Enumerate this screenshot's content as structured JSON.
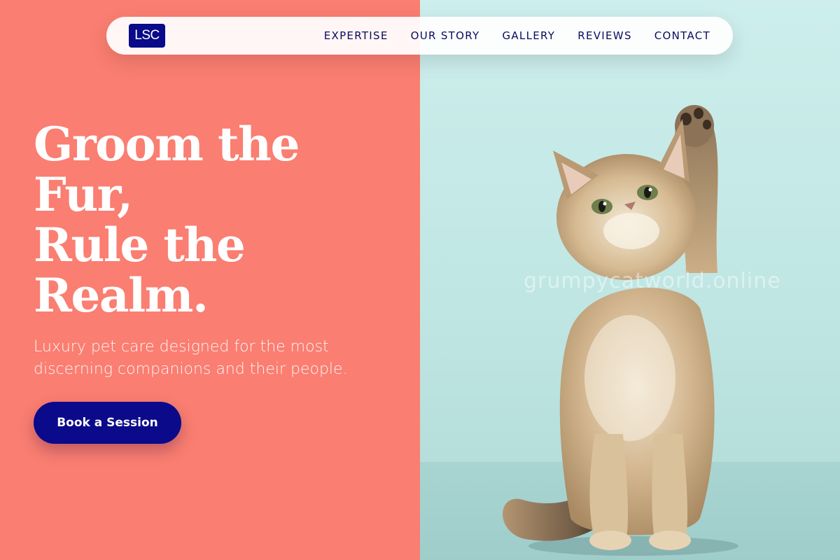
{
  "brand": {
    "logo_text": "LSC"
  },
  "nav": {
    "items": [
      {
        "label": "EXPERTISE"
      },
      {
        "label": "OUR STORY"
      },
      {
        "label": "GALLERY"
      },
      {
        "label": "REVIEWS"
      },
      {
        "label": "CONTACT"
      }
    ]
  },
  "hero": {
    "headline_lines": [
      "Groom the",
      "Fur,",
      "Rule the",
      "Realm."
    ],
    "subtitle": "Luxury pet care designed for the most discerning companions and their people.",
    "cta_label": "Book a Session"
  },
  "image": {
    "watermark": "grumpycatworld.online",
    "subject": "kitten-raising-paw"
  },
  "colors": {
    "left_panel": "#FA7E71",
    "right_panel": "#CDEEEC",
    "accent_navy": "#0A0A8A",
    "nav_text": "#0B0B5C"
  }
}
